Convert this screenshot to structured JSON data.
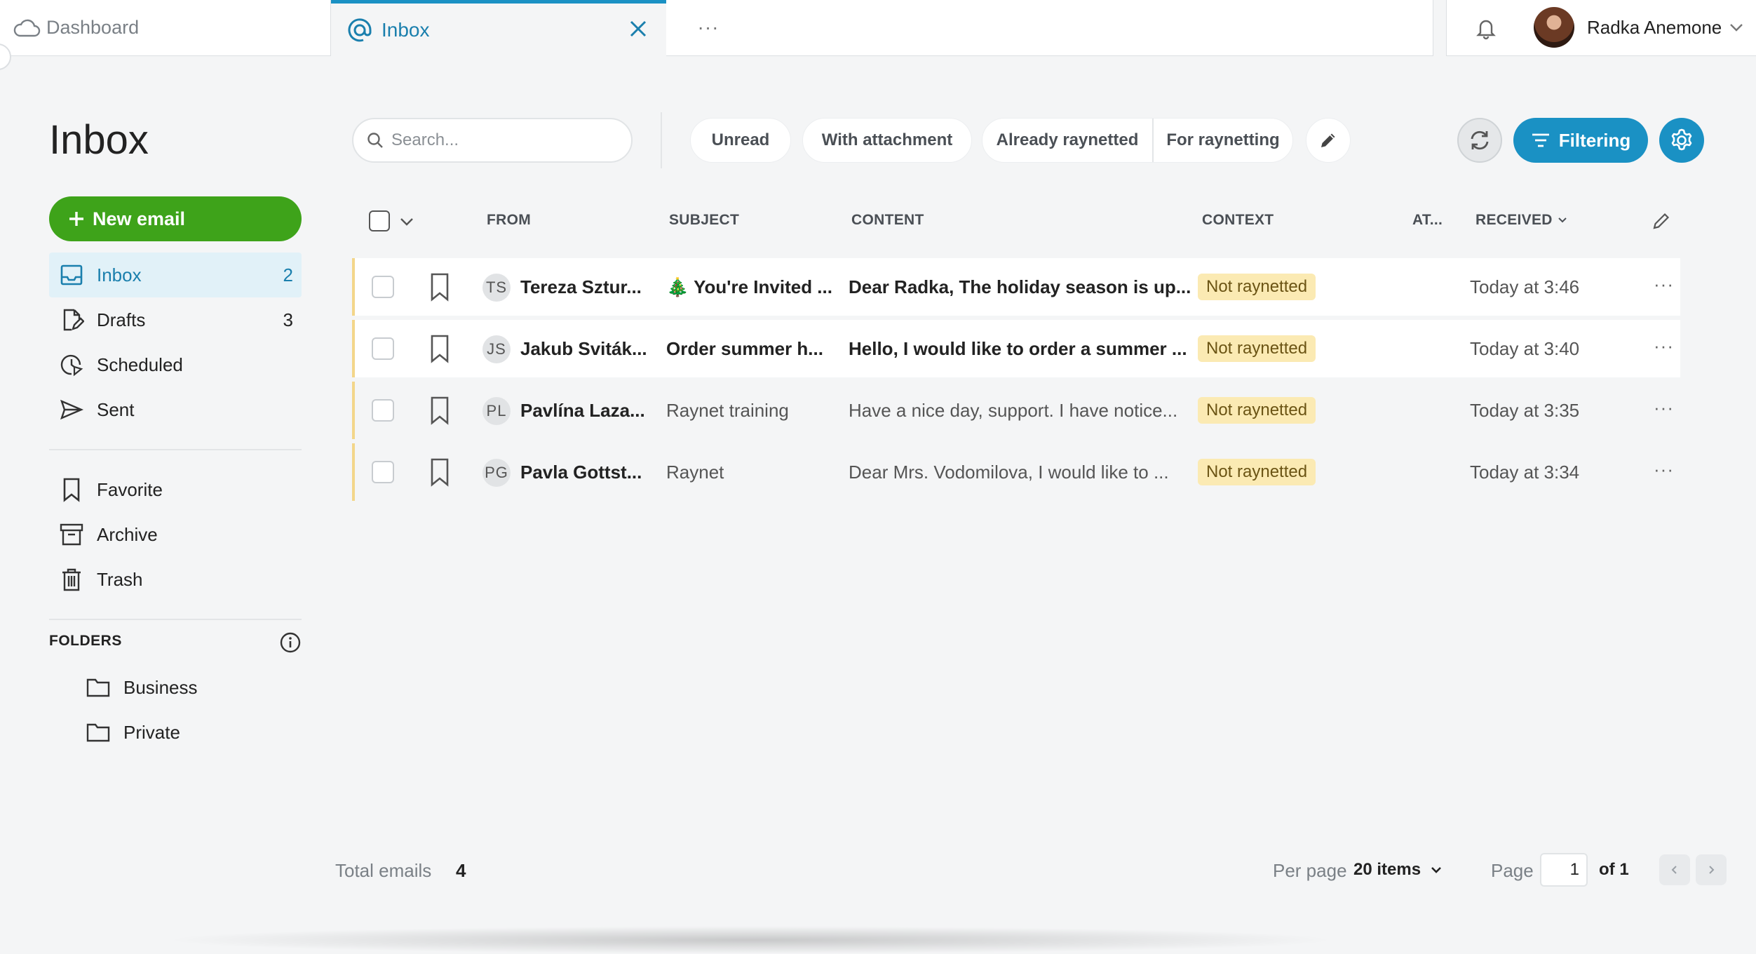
{
  "tabs": {
    "dashboard": "Dashboard",
    "inbox": "Inbox",
    "more": "···"
  },
  "user": {
    "name": "Radka Anemone"
  },
  "page_title": "Inbox",
  "sidebar": {
    "new_email": "New email",
    "items": [
      {
        "label": "Inbox",
        "count": "2",
        "icon": "inbox-icon"
      },
      {
        "label": "Drafts",
        "count": "3",
        "icon": "drafts-icon"
      },
      {
        "label": "Scheduled",
        "count": "",
        "icon": "scheduled-icon"
      },
      {
        "label": "Sent",
        "count": "",
        "icon": "sent-icon"
      }
    ],
    "secondary": [
      {
        "label": "Favorite",
        "icon": "bookmark-icon"
      },
      {
        "label": "Archive",
        "icon": "archive-icon"
      },
      {
        "label": "Trash",
        "icon": "trash-icon"
      }
    ],
    "folders_label": "FOLDERS",
    "folders": [
      {
        "label": "Business"
      },
      {
        "label": "Private"
      }
    ]
  },
  "toolbar": {
    "search_placeholder": "Search...",
    "chips": {
      "unread": "Unread",
      "with_attachment": "With attachment",
      "already_raynetted": "Already raynetted",
      "for_raynetting": "For raynetting"
    },
    "filtering": "Filtering"
  },
  "table": {
    "headers": {
      "from": "FROM",
      "subject": "SUBJECT",
      "content": "CONTENT",
      "context": "CONTEXT",
      "attachment": "AT...",
      "received": "RECEIVED"
    },
    "rows": [
      {
        "initials": "TS",
        "from": "Tereza Sztur...",
        "subject": "🎄 You're Invited ...",
        "content": "Dear Radka, The holiday season is up...",
        "context": "Not raynetted",
        "received": "Today at 3:46",
        "read": false
      },
      {
        "initials": "JS",
        "from": "Jakub Sviták...",
        "subject": "Order summer h...",
        "content": "Hello, I would like to order a summer ...",
        "context": "Not raynetted",
        "received": "Today at 3:40",
        "read": false
      },
      {
        "initials": "PL",
        "from": "Pavlína Laza...",
        "subject": "Raynet training",
        "content": "Have a nice day, support. I have notice...",
        "context": "Not raynetted",
        "received": "Today at 3:35",
        "read": true
      },
      {
        "initials": "PG",
        "from": "Pavla Gottst...",
        "subject": "Raynet",
        "content": "Dear Mrs. Vodomilova, I would like to ...",
        "context": "Not raynetted",
        "received": "Today at 3:34",
        "read": true
      }
    ]
  },
  "footer": {
    "total_label": "Total emails",
    "total_value": "4",
    "per_page_label": "Per page",
    "per_page_value": "20 items",
    "page_label": "Page",
    "page_value": "1",
    "page_of": "of 1"
  },
  "colors": {
    "accent": "#1a91c4",
    "new_email": "#3ea31a",
    "context_badge": "#fbeab3"
  }
}
